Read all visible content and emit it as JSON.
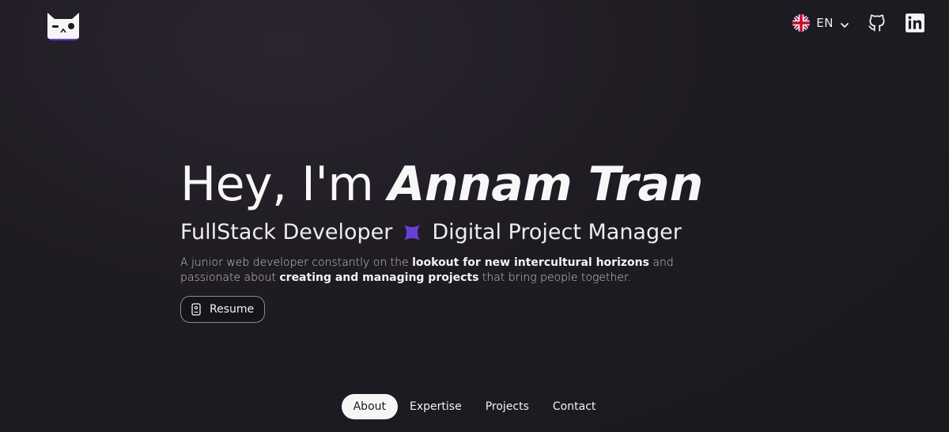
{
  "header": {
    "logo_icon": "cat-face-logo-icon",
    "language": {
      "flag_icon": "uk-flag-icon",
      "code": "EN",
      "dropdown_icon": "chevron-down-icon"
    },
    "socials": [
      {
        "icon": "github-icon"
      },
      {
        "icon": "linkedin-icon"
      }
    ]
  },
  "hero": {
    "greeting": "Hey, I'm ",
    "name": "Annam Tran",
    "role_1": "FullStack Developer",
    "separator_icon": "purple-sparkle-icon",
    "role_2": "Digital Project Manager",
    "description": {
      "part1": "A junior web developer constantly on the ",
      "highlight1": "lookout for new intercultural horizons",
      "part2": " and passionate about ",
      "highlight2": "creating and managing projects",
      "part3": " that bring people together."
    },
    "resume_label": "Resume",
    "resume_icon": "document-icon"
  },
  "nav": {
    "items": [
      {
        "label": "About",
        "active": true
      },
      {
        "label": "Expertise",
        "active": false
      },
      {
        "label": "Projects",
        "active": false
      },
      {
        "label": "Contact",
        "active": false
      }
    ]
  },
  "colors": {
    "background": "#1f1b22",
    "accent": "#6a3fd6",
    "text": "#f4f4f4"
  }
}
